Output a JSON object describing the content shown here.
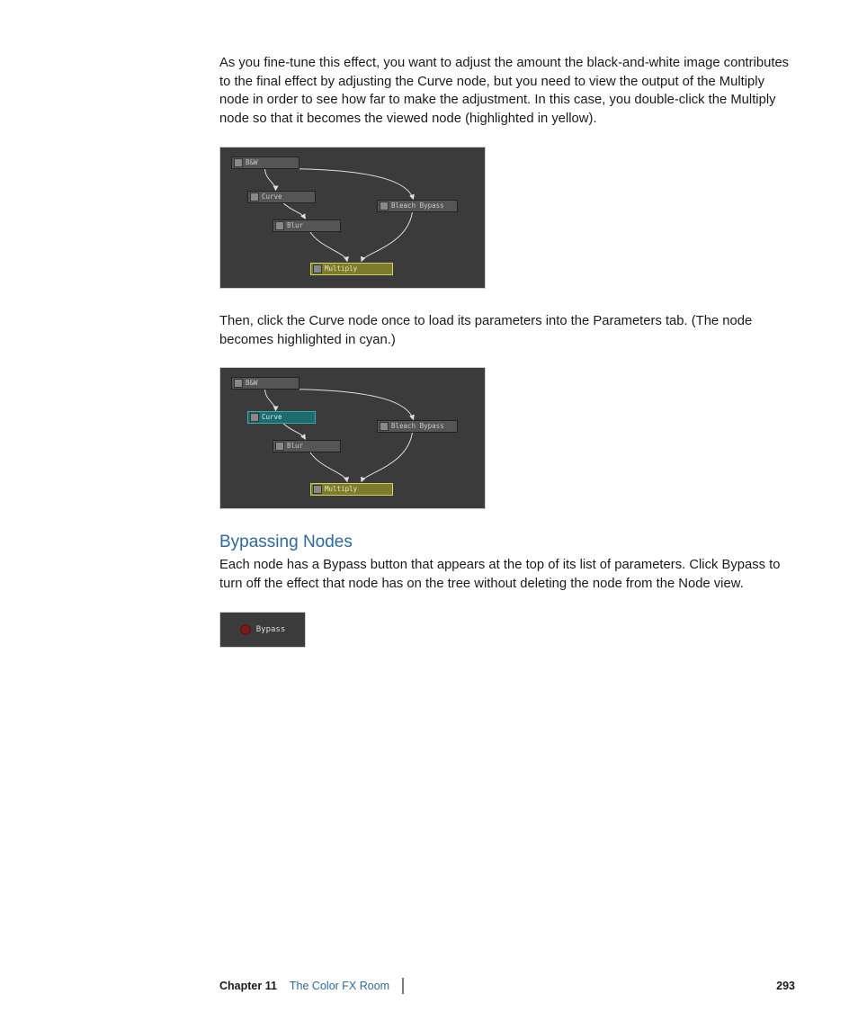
{
  "para1": "As you fine-tune this effect, you want to adjust the amount the black-and-white image contributes to the final effect by adjusting the Curve node, but you need to view the output of the Multiply node in order to see how far to make the adjustment. In this case, you double-click the Multiply node so that it becomes the viewed node (highlighted in yellow).",
  "para2": "Then, click the Curve node once to load its parameters into the Parameters tab. (The node becomes highlighted in cyan.)",
  "heading1": "Bypassing Nodes",
  "para3": "Each node has a Bypass button that appears at the top of its list of parameters. Click Bypass to turn off the effect that node has on the tree without deleting the node from the Node view.",
  "nodes": {
    "bw": "B&W",
    "curve": "Curve",
    "blur": "Blur",
    "bleach": "Bleach Bypass",
    "multiply": "Multiply"
  },
  "bypass": "Bypass",
  "footer": {
    "chapter": "Chapter 11",
    "title": "The Color FX Room",
    "page": "293"
  }
}
